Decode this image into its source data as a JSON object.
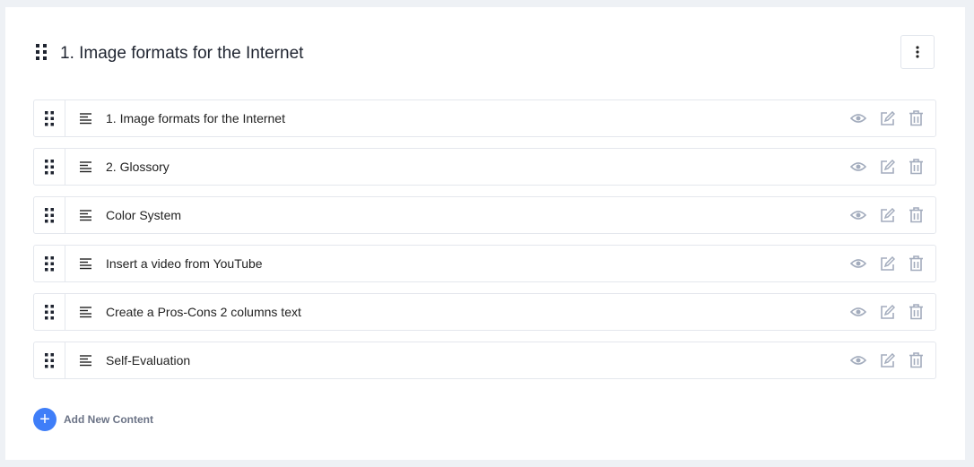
{
  "section": {
    "title": "1. Image formats for the Internet"
  },
  "items": [
    {
      "label": "1. Image formats for the Internet"
    },
    {
      "label": "2. Glossory"
    },
    {
      "label": "Color System"
    },
    {
      "label": "Insert a video from YouTube"
    },
    {
      "label": "Create a Pros-Cons 2 columns text"
    },
    {
      "label": "Self-Evaluation"
    }
  ],
  "add_button": {
    "label": "Add New Content"
  },
  "icons": {
    "drag": "drag-handle-icon",
    "text": "text-lines-icon",
    "preview": "eye-icon",
    "edit": "edit-icon",
    "delete": "trash-icon",
    "more": "more-vertical-icon"
  },
  "colors": {
    "accent": "#3f7ef8",
    "action_icon": "#a3acbd"
  }
}
